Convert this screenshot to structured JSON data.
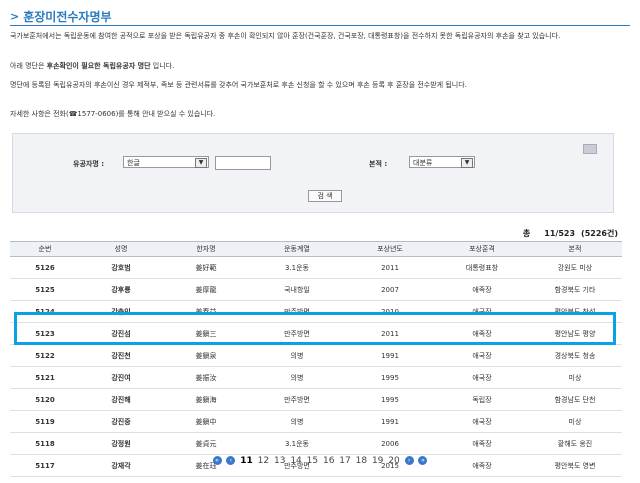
{
  "page": {
    "title": "훈장미전수자명부",
    "intro_1": "국가보훈처에서는 독립운동에 참여한 공적으로 포상을 받은 독립유공자 중 후손이 확인되지 않아 훈장(건국훈장, 건국포장, 대통령표창)을 전수하지 못한 독립유공자의 후손을 찾고 있습니다.",
    "intro_2_pre": "아래 명단은 ",
    "intro_2_bold": "후손확인이 필요한 독립유공자 명단",
    "intro_2_post": " 입니다.",
    "intro_3": "명단에 등록된 독립유공자의 후손이신 경우 제적부, 족보 등 관련서류를 갖추어 국가보훈처로 후손 신청을 할 수 있으며 후손 등록 후 훈장을 전수받게 됩니다.",
    "intro_4": "자세한 사항은 전화(☎1577-0606)를 통해 안내 받으실 수 있습니다."
  },
  "search": {
    "name_label": "유공자명 :",
    "lang_value": "한글",
    "bonjeok_label": "본적 :",
    "bonjeok_value": "대분류",
    "button_label": "검 색"
  },
  "results": {
    "count_label": "총",
    "page_info": "11/523",
    "total": "(5226건)"
  },
  "table": {
    "headers": [
      "순번",
      "성명",
      "한자명",
      "운동계열",
      "포상년도",
      "포상훈격",
      "본적"
    ],
    "rows": [
      [
        "5126",
        "강호범",
        "姜好範",
        "3.1운동",
        "2011",
        "대통령표창",
        "강원도 미상"
      ],
      [
        "5125",
        "강후룡",
        "姜厚龍",
        "국내항일",
        "2007",
        "애족장",
        "함경북도 기타"
      ],
      [
        "5124",
        "강춘익",
        "姜春益",
        "만주방면",
        "2010",
        "애국장",
        "평안북도 창성"
      ],
      [
        "5123",
        "강진섬",
        "姜鎭三",
        "만주방면",
        "2011",
        "애족장",
        "평안남도 평양"
      ],
      [
        "5122",
        "강진천",
        "姜鎭泉",
        "의병",
        "1991",
        "애국장",
        "경상북도 청송"
      ],
      [
        "5121",
        "강진여",
        "姜振汝",
        "의병",
        "1995",
        "애국장",
        "미상"
      ],
      [
        "5120",
        "강진해",
        "姜鎭海",
        "만주방면",
        "1995",
        "독립장",
        "함경남도 단천"
      ],
      [
        "5119",
        "강진중",
        "姜鎭中",
        "의병",
        "1991",
        "애국장",
        "미상"
      ],
      [
        "5118",
        "강정원",
        "姜貞元",
        "3.1운동",
        "2006",
        "애족장",
        "황해도 옹진"
      ],
      [
        "5117",
        "강재각",
        "姜在珏",
        "만주방면",
        "2015",
        "애족장",
        "평안북도 영변"
      ]
    ]
  },
  "pager": {
    "pages": [
      "11",
      "12",
      "13",
      "14",
      "15",
      "16",
      "17",
      "18",
      "19",
      "20"
    ],
    "current": "11"
  },
  "colors": {
    "accent": "#2a7bbf",
    "highlight_border": "#0aa1e6"
  }
}
